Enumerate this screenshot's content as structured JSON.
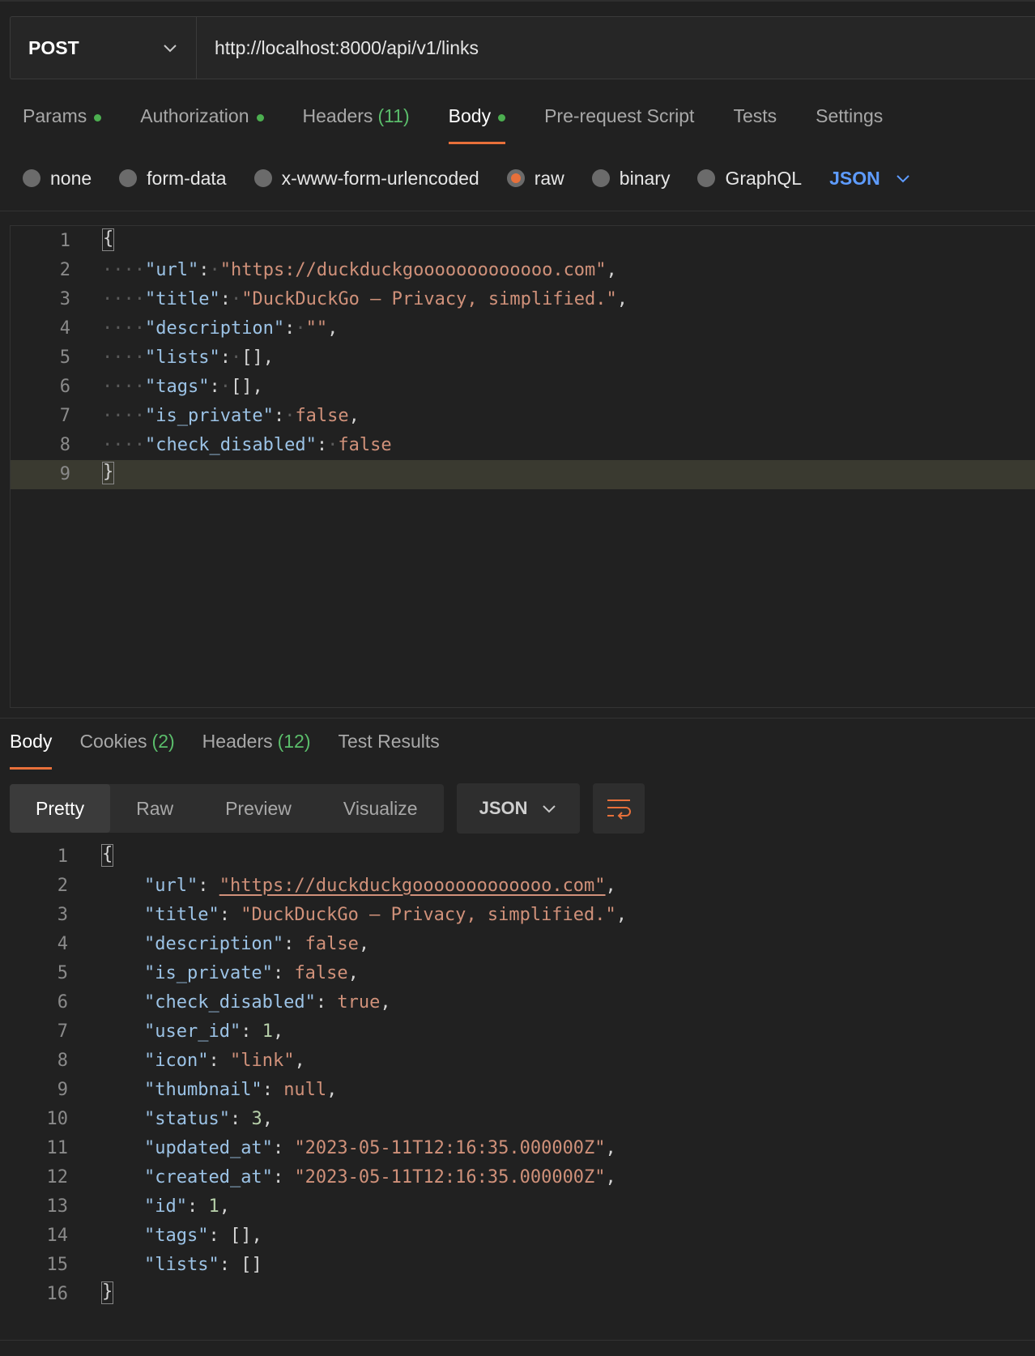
{
  "request": {
    "method": "POST",
    "url": "http://localhost:8000/api/v1/links",
    "tabs": {
      "params": "Params",
      "authorization": "Authorization",
      "headers": "Headers",
      "headers_count": "(11)",
      "body": "Body",
      "prerequest": "Pre-request Script",
      "tests": "Tests",
      "settings": "Settings"
    },
    "body_types": {
      "none": "none",
      "form_data": "form-data",
      "urlencoded": "x-www-form-urlencoded",
      "raw": "raw",
      "binary": "binary",
      "graphql": "GraphQL",
      "selected_language": "JSON"
    },
    "body_lines": [
      {
        "n": "1",
        "key": "",
        "val": ""
      },
      {
        "n": "2",
        "key": "\"url\"",
        "val": "\"https://duckduckgooooooooooooo.com\""
      },
      {
        "n": "3",
        "key": "\"title\"",
        "val": "\"DuckDuckGo — Privacy, simplified.\""
      },
      {
        "n": "4",
        "key": "\"description\"",
        "val": "\"\""
      },
      {
        "n": "5",
        "key": "\"lists\"",
        "val": "[]"
      },
      {
        "n": "6",
        "key": "\"tags\"",
        "val": "[]"
      },
      {
        "n": "7",
        "key": "\"is_private\"",
        "val": "false"
      },
      {
        "n": "8",
        "key": "\"check_disabled\"",
        "val": "false"
      },
      {
        "n": "9",
        "key": "",
        "val": ""
      }
    ]
  },
  "response": {
    "tabs": {
      "body": "Body",
      "cookies": "Cookies",
      "cookies_count": "(2)",
      "headers": "Headers",
      "headers_count": "(12)",
      "test_results": "Test Results"
    },
    "views": {
      "pretty": "Pretty",
      "raw": "Raw",
      "preview": "Preview",
      "visualize": "Visualize"
    },
    "format": "JSON",
    "lines": [
      {
        "n": "1"
      },
      {
        "n": "2",
        "key": "\"url\"",
        "val": "\"https://duckduckgooooooooooooo.com\""
      },
      {
        "n": "3",
        "key": "\"title\"",
        "val": "\"DuckDuckGo — Privacy, simplified.\""
      },
      {
        "n": "4",
        "key": "\"description\"",
        "val": "false"
      },
      {
        "n": "5",
        "key": "\"is_private\"",
        "val": "false"
      },
      {
        "n": "6",
        "key": "\"check_disabled\"",
        "val": "true"
      },
      {
        "n": "7",
        "key": "\"user_id\"",
        "val": "1"
      },
      {
        "n": "8",
        "key": "\"icon\"",
        "val": "\"link\""
      },
      {
        "n": "9",
        "key": "\"thumbnail\"",
        "val": "null"
      },
      {
        "n": "10",
        "key": "\"status\"",
        "val": "3"
      },
      {
        "n": "11",
        "key": "\"updated_at\"",
        "val": "\"2023-05-11T12:16:35.000000Z\""
      },
      {
        "n": "12",
        "key": "\"created_at\"",
        "val": "\"2023-05-11T12:16:35.000000Z\""
      },
      {
        "n": "13",
        "key": "\"id\"",
        "val": "1"
      },
      {
        "n": "14",
        "key": "\"tags\"",
        "val": "[]"
      },
      {
        "n": "15",
        "key": "\"lists\"",
        "val": "[]"
      },
      {
        "n": "16"
      }
    ]
  },
  "colors": {
    "accent": "#e8703a",
    "link": "#5e9cff",
    "dot": "#4caf50"
  }
}
